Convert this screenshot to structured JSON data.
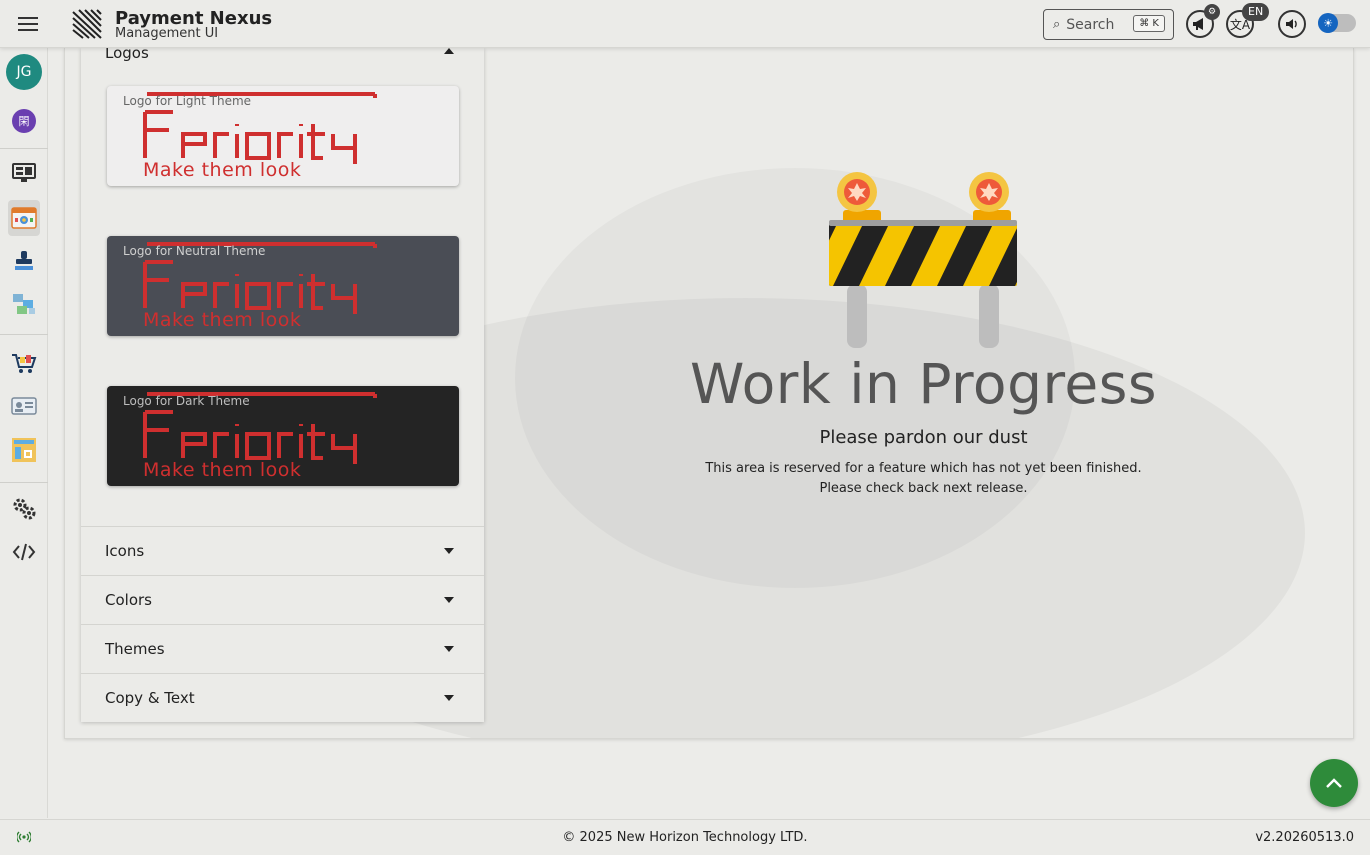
{
  "app": {
    "title": "Payment Nexus",
    "subtitle": "Management UI",
    "user_initials": "JG",
    "org_glyph": "閑"
  },
  "toolbar": {
    "search_placeholder": "Search",
    "search_shortcut": "⌘ K",
    "language": "EN",
    "notification_glyph": "⚙",
    "theme_toggle_state": "light",
    "accent_color": "#1565c0"
  },
  "sidebar": {
    "items": [
      {
        "icon": "dashboard-monitor-icon"
      },
      {
        "icon": "branding-browser-icon",
        "active": true
      },
      {
        "icon": "stamp-icon"
      },
      {
        "icon": "flow-puzzle-icon"
      },
      {
        "icon": "shopping-cart-icon"
      },
      {
        "icon": "id-card-icon"
      },
      {
        "icon": "report-chart-icon"
      },
      {
        "icon": "settings-gears-icon"
      },
      {
        "icon": "code-icon"
      }
    ]
  },
  "panel": {
    "sections": [
      {
        "label": "Logos",
        "expanded": true
      },
      {
        "label": "Icons",
        "expanded": false
      },
      {
        "label": "Colors",
        "expanded": false
      },
      {
        "label": "Themes",
        "expanded": false
      },
      {
        "label": "Copy & Text",
        "expanded": false
      }
    ],
    "logos": [
      {
        "caption": "Logo for Light Theme",
        "bg": "#efeeee",
        "caption_color": "#666666"
      },
      {
        "caption": "Logo for Neutral Theme",
        "bg": "#4a4d55",
        "caption_color": "#cfcfcf"
      },
      {
        "caption": "Logo for Dark Theme",
        "bg": "#242424",
        "caption_color": "#bdbdbd"
      }
    ],
    "logo_tagline": "Make them look",
    "logo_color": "#cf2f2f"
  },
  "main": {
    "title": "Work in Progress",
    "subtitle": "Please pardon our dust",
    "line1": "This area is reserved for a feature which has not yet been finished.",
    "line2": "Please check back next release."
  },
  "footer": {
    "copyright": "© 2025 New Horizon Technology LTD.",
    "version": "v2.20260513.0"
  },
  "fab": {
    "icon": "chevron-up-icon",
    "color": "#2e8b3a"
  }
}
